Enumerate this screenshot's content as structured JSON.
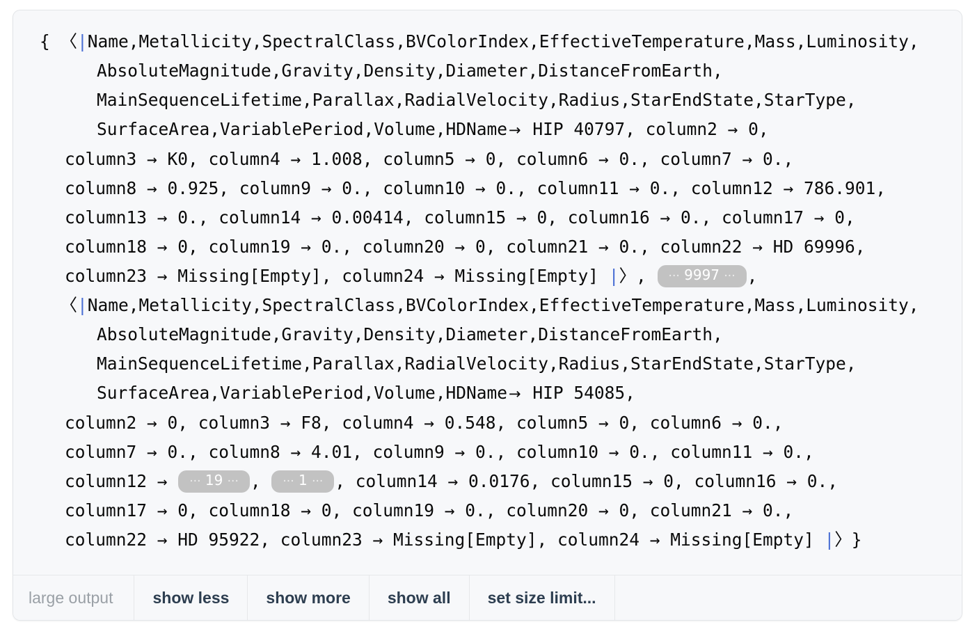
{
  "cell": {
    "kind": "wolfram-output-cell",
    "background": "#f7f8fa",
    "border_color": "#e3e5e8"
  },
  "expression": {
    "open_brace": "{",
    "close_brace": "}",
    "assoc_open_angle": "〈",
    "assoc_open_bar": "|",
    "assoc_close_bar": "|",
    "assoc_close_angle": "〉",
    "arrow": "→",
    "keys_line1": "Name,Metallicity,SpectralClass,BVColorIndex,EffectiveTemperature,Mass,Luminosity,",
    "keys_line2": "AbsoluteMagnitude,Gravity,Density,Diameter,DistanceFromEarth,",
    "keys_line3": "MainSequenceLifetime,Parallax,RadialVelocity,Radius,StarEndState,StarType,",
    "keys_line4_prefix": "SurfaceArea,VariablePeriod,Volume,HDName"
  },
  "record1": {
    "hdname_value": "HIP 40797",
    "line_after_hdname": " HIP 40797, column2 → 0,",
    "lines": [
      "column3 → K0, column4 → 1.008, column5 → 0, column6 → 0., column7 → 0.,",
      "column8 → 0.925, column9 → 0., column10 → 0., column11 → 0., column12 → 786.901,",
      "column13 → 0., column14 → 0.00414, column15 → 0, column16 → 0., column17 → 0,",
      "column18 → 0, column19 → 0., column20 → 0, column21 → 0., column22 → HD 69996,"
    ],
    "final_line_prefix": "column23 → Missing[Empty], column24 → Missing[Empty] ",
    "final_line_suffix": ", "
  },
  "skipped_pill_main": {
    "text": "9997",
    "left_dots": "···",
    "right_dots": "···",
    "bg": "#c2c2c2",
    "fg": "#ffffff"
  },
  "record2": {
    "hdname_value": "HIP 54085",
    "line_after_hdname": " HIP 54085,",
    "lines_before_pills": [
      "column2 → 0, column3 → F8, column4 → 0.548, column5 → 0, column6 → 0.,",
      "column7 → 0., column8 → 4.01, column9 → 0., column10 → 0., column11 → 0.,"
    ],
    "pill_line_prefix": "column12 → ",
    "pill_line_mid": ", ",
    "pill_line_suffix": ", column14 → 0.0176, column15 → 0, column16 → 0.,",
    "pill_a": "19",
    "pill_b": "1",
    "lines_after_pills": [
      "column17 → 0, column18 → 0, column19 → 0., column20 → 0, column21 → 0.,"
    ],
    "final_line_prefix": "column22 → HD 95922, column23 → Missing[Empty], column24 → Missing[Empty] "
  },
  "footer": {
    "status_label": "large output",
    "buttons": [
      {
        "label": "show less",
        "name": "show-less-button"
      },
      {
        "label": "show more",
        "name": "show-more-button"
      },
      {
        "label": "show all",
        "name": "show-all-button"
      },
      {
        "label": "set size limit...",
        "name": "set-size-limit-button"
      }
    ]
  }
}
